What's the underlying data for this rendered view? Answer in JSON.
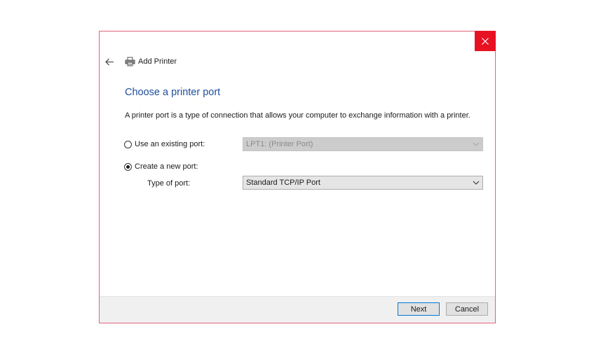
{
  "window": {
    "title": "Add Printer",
    "close_icon": "close-icon",
    "back_icon": "back-arrow-icon",
    "app_icon": "printer-icon",
    "close_color": "#e81123"
  },
  "page": {
    "heading": "Choose a printer port",
    "description": "A printer port is a type of connection that allows your computer to exchange information with a printer."
  },
  "options": {
    "existing": {
      "label": "Use an existing port:",
      "selected": false,
      "value": "LPT1: (Printer Port)",
      "enabled": false
    },
    "create": {
      "label": "Create a new port:",
      "selected": true
    },
    "type_of_port": {
      "label": "Type of port:",
      "value": "Standard TCP/IP Port"
    }
  },
  "footer": {
    "next_label": "Next",
    "cancel_label": "Cancel"
  },
  "colors": {
    "heading": "#1f4e9c",
    "accent": "#0078d7",
    "window_border": "#e0637f"
  }
}
